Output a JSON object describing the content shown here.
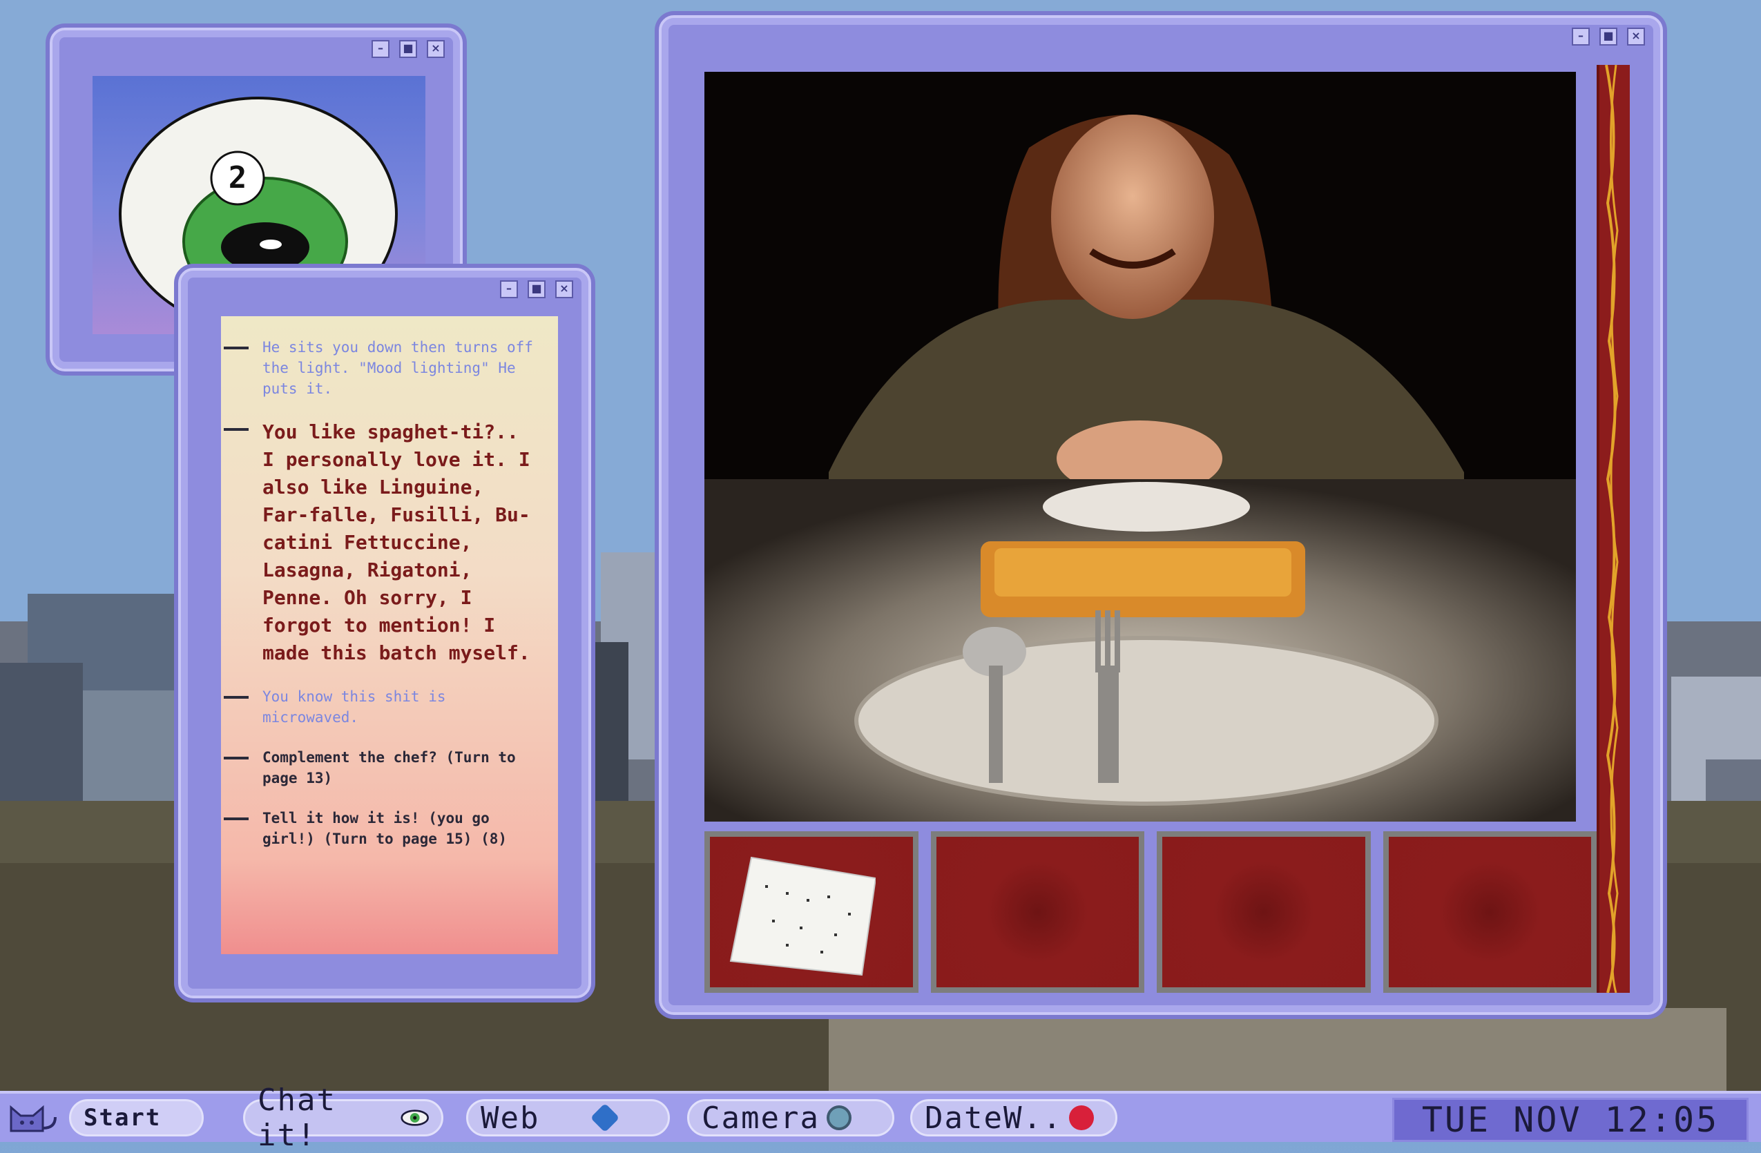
{
  "dialog": {
    "entries": [
      {
        "text": "He sits you down then turns off the light. \"Mood lighting\" He puts it.",
        "style": "narration"
      },
      {
        "text": "You like spaghet-ti?.. I personally love it. I also like Linguine, Far-falle, Fusilli, Bu-catini Fettuccine, Lasagna, Rigatoni, Penne. Oh sorry, I forgot to mention! I made this batch myself.",
        "style": "speech"
      },
      {
        "text": "You know this shit is microwaved.",
        "style": "thought"
      },
      {
        "text": "Complement the chef? (Turn to page 13)",
        "style": "choice"
      },
      {
        "text": "Tell it how it is! (you go girl!) (Turn to page 15) (8)",
        "style": "choice"
      }
    ]
  },
  "eye": {
    "badge_number": "2"
  },
  "window_controls": {
    "minimize": "–",
    "maximize": "■",
    "close": "×"
  },
  "taskbar": {
    "start_label": "Start",
    "apps": [
      {
        "label": "Chat it!",
        "icon": "eye-icon",
        "icon_color": "#3fa84a"
      },
      {
        "label": "Web",
        "icon": "globe-icon",
        "icon_color": "#2f6fc8"
      },
      {
        "label": "Camera",
        "icon": "camera-lens-icon",
        "icon_color": "#6fa0b8"
      },
      {
        "label": "DateW..",
        "icon": "heart-icon",
        "icon_color": "#d8203a"
      }
    ],
    "clock": "TUE NOV 12:05"
  },
  "colors": {
    "window_frame": "#8e8cde",
    "accent_red": "#8b1c1c",
    "narration_blue": "#7b86e0",
    "speech_red": "#7a1b1b"
  }
}
